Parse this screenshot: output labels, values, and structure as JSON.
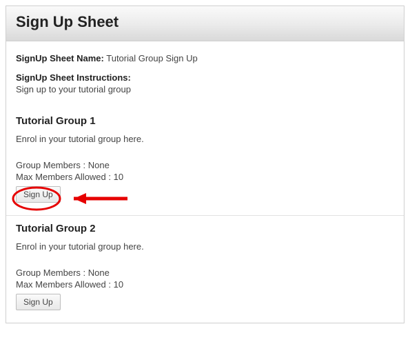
{
  "header": {
    "title": "Sign Up Sheet"
  },
  "meta": {
    "name_label": "SignUp Sheet Name:",
    "name_value": "Tutorial Group Sign Up",
    "instructions_label": "SignUp Sheet Instructions:",
    "instructions_value": "Sign up to your tutorial group"
  },
  "groups": [
    {
      "title": "Tutorial Group 1",
      "description": "Enrol in your tutorial group here.",
      "members_label": "Group Members :",
      "members_value": "None",
      "max_label": "Max Members Allowed :",
      "max_value": "10",
      "button_label": "Sign Up"
    },
    {
      "title": "Tutorial Group 2",
      "description": "Enrol in your tutorial group here.",
      "members_label": "Group Members :",
      "members_value": "None",
      "max_label": "Max Members Allowed :",
      "max_value": "10",
      "button_label": "Sign Up"
    }
  ],
  "annotation": {
    "color": "#e60000"
  }
}
